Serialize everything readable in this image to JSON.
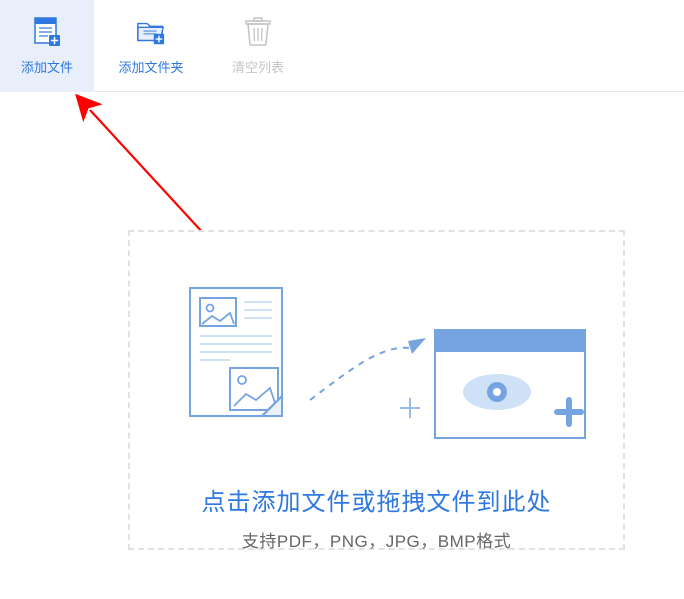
{
  "toolbar": {
    "items": [
      {
        "label": "添加文件"
      },
      {
        "label": "添加文件夹"
      },
      {
        "label": "清空列表"
      }
    ]
  },
  "dropzone": {
    "title": "点击添加文件或拖拽文件到此处",
    "subtitle": "支持PDF，PNG，JPG，BMP格式"
  },
  "colors": {
    "accent": "#2f78e0",
    "activeBg": "#e8effa",
    "disabled": "#c3c4c5",
    "annotation": "#ff0000"
  }
}
